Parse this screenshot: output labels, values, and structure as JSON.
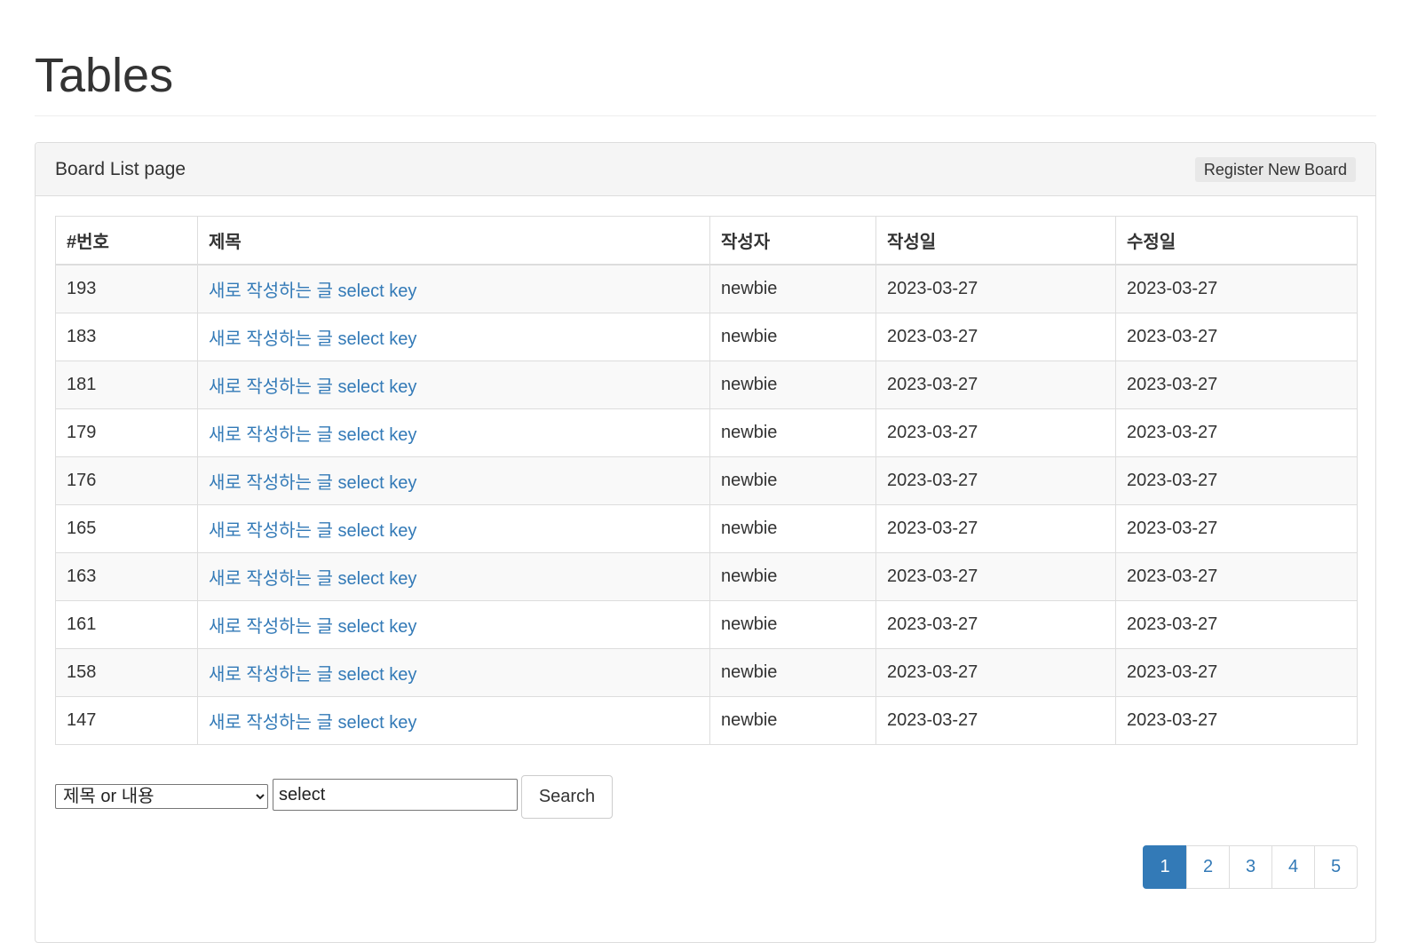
{
  "page": {
    "title": "Tables"
  },
  "panel": {
    "heading": "Board List page",
    "register_button": "Register New Board"
  },
  "table": {
    "headers": [
      "#번호",
      "제목",
      "작성자",
      "작성일",
      "수정일"
    ],
    "rows": [
      {
        "no": "193",
        "title": "새로 작성하는 글 select key",
        "writer": "newbie",
        "regdate": "2023-03-27",
        "updatedate": "2023-03-27"
      },
      {
        "no": "183",
        "title": "새로 작성하는 글 select key",
        "writer": "newbie",
        "regdate": "2023-03-27",
        "updatedate": "2023-03-27"
      },
      {
        "no": "181",
        "title": "새로 작성하는 글 select key",
        "writer": "newbie",
        "regdate": "2023-03-27",
        "updatedate": "2023-03-27"
      },
      {
        "no": "179",
        "title": "새로 작성하는 글 select key",
        "writer": "newbie",
        "regdate": "2023-03-27",
        "updatedate": "2023-03-27"
      },
      {
        "no": "176",
        "title": "새로 작성하는 글 select key",
        "writer": "newbie",
        "regdate": "2023-03-27",
        "updatedate": "2023-03-27"
      },
      {
        "no": "165",
        "title": "새로 작성하는 글 select key",
        "writer": "newbie",
        "regdate": "2023-03-27",
        "updatedate": "2023-03-27"
      },
      {
        "no": "163",
        "title": "새로 작성하는 글 select key",
        "writer": "newbie",
        "regdate": "2023-03-27",
        "updatedate": "2023-03-27"
      },
      {
        "no": "161",
        "title": "새로 작성하는 글 select key",
        "writer": "newbie",
        "regdate": "2023-03-27",
        "updatedate": "2023-03-27"
      },
      {
        "no": "158",
        "title": "새로 작성하는 글 select key",
        "writer": "newbie",
        "regdate": "2023-03-27",
        "updatedate": "2023-03-27"
      },
      {
        "no": "147",
        "title": "새로 작성하는 글 select key",
        "writer": "newbie",
        "regdate": "2023-03-27",
        "updatedate": "2023-03-27"
      }
    ]
  },
  "search": {
    "type_selected": "제목 or 내용",
    "keyword_value": "select",
    "button_label": "Search"
  },
  "pagination": {
    "pages": [
      "1",
      "2",
      "3",
      "4",
      "5"
    ],
    "active_page": "1"
  },
  "colors": {
    "link": "#337ab7",
    "active_page_bg": "#337ab7",
    "striped_row": "#f9f9f9",
    "panel_heading_bg": "#f5f5f5"
  }
}
